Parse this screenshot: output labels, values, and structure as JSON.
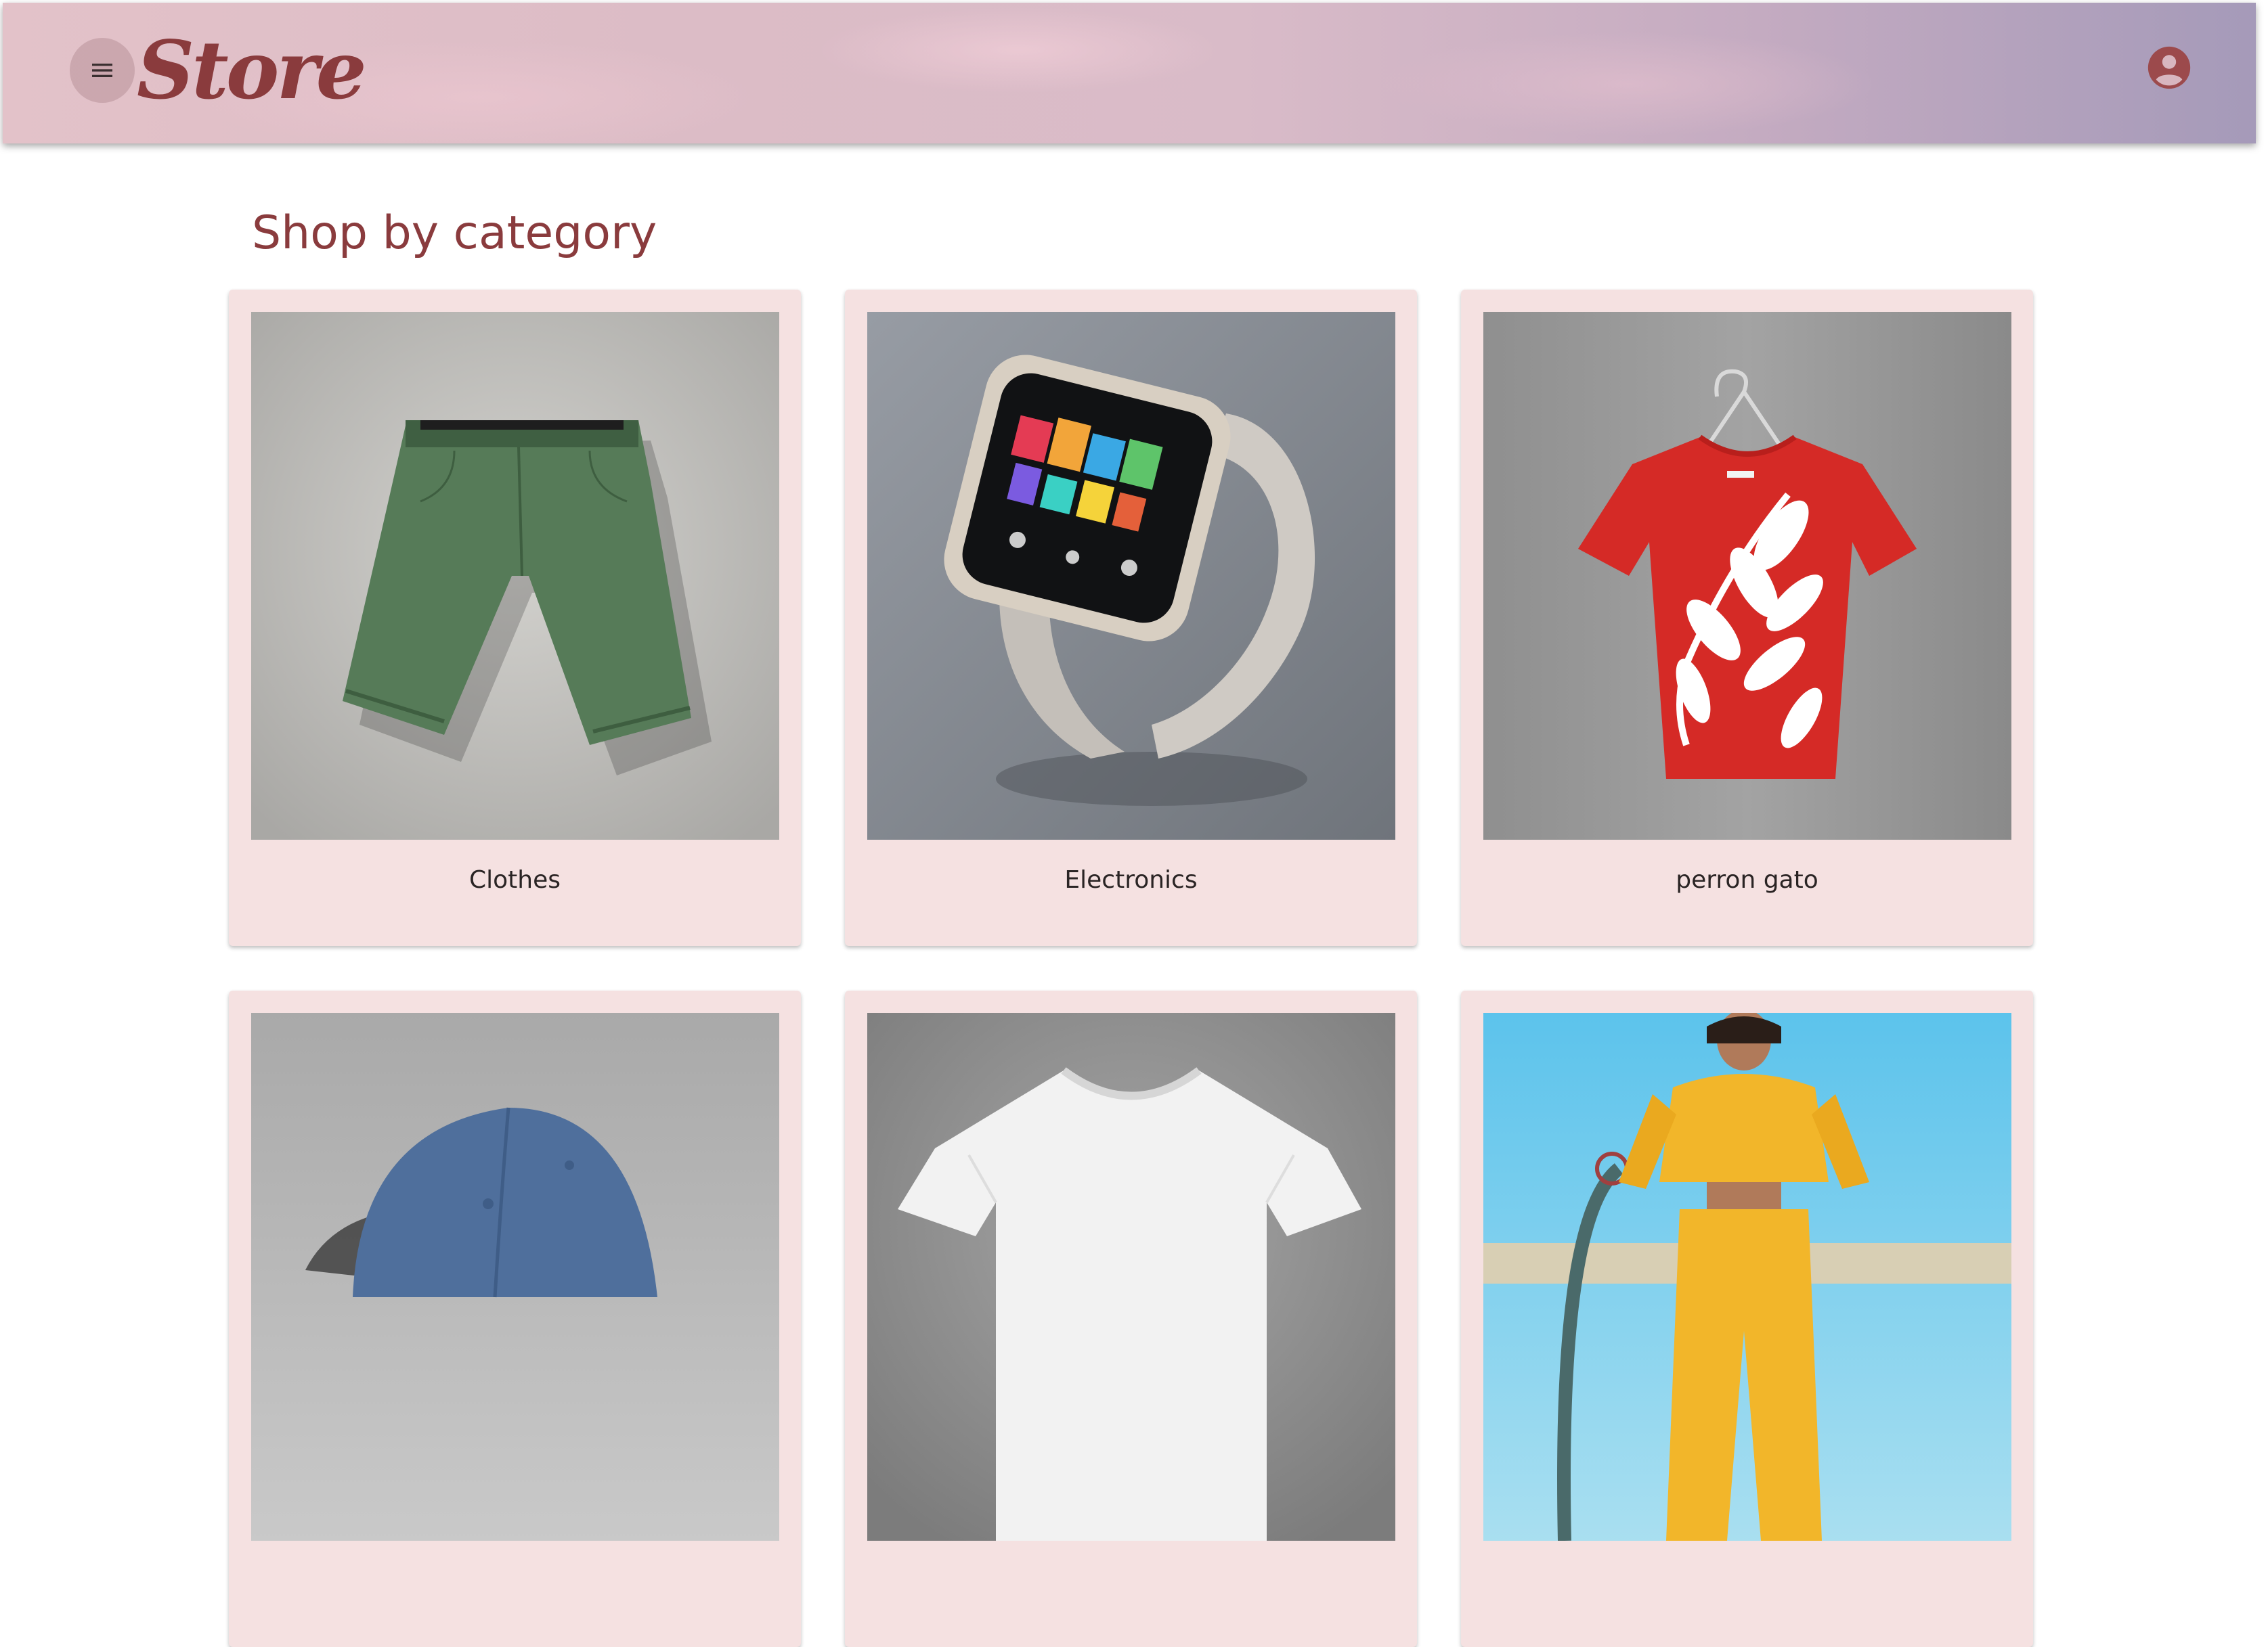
{
  "app": {
    "logo": "Store",
    "menu_icon": "hamburger-menu-icon",
    "account_icon": "account-circle-icon"
  },
  "section": {
    "title": "Shop by category"
  },
  "categories": [
    {
      "label": "Clothes",
      "image": "green-shorts"
    },
    {
      "label": "Electronics",
      "image": "smartwatch"
    },
    {
      "label": "perron gato",
      "image": "red-tshirt"
    },
    {
      "label": "",
      "image": "blue-cap"
    },
    {
      "label": "",
      "image": "white-tshirt"
    },
    {
      "label": "",
      "image": "yellow-tracksuit"
    }
  ],
  "colors": {
    "brand": "#8a3b3d",
    "card_background": "#f5e1e1",
    "header_gradient_start": "#e3c2c9",
    "header_gradient_end": "#a59ab9"
  }
}
